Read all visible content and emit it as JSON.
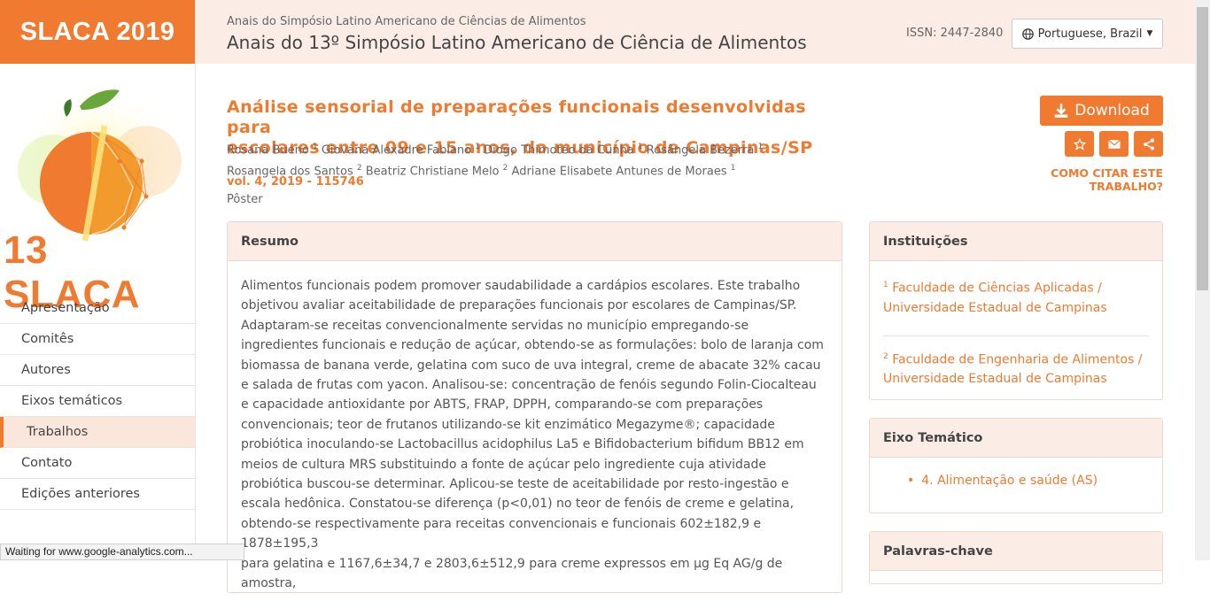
{
  "brand": {
    "title": "SLACA 2019",
    "logo_text": "13 SLACA"
  },
  "nav": {
    "items": [
      {
        "label": "Apresentação"
      },
      {
        "label": "Comitês"
      },
      {
        "label": "Autores"
      },
      {
        "label": "Eixos temáticos"
      },
      {
        "label": "Trabalhos"
      },
      {
        "label": "Contato"
      },
      {
        "label": "Edições anteriores"
      }
    ],
    "active": "Trabalhos"
  },
  "header": {
    "subtitle": "Anais do Simpósio Latino Americano de Ciências de Alimentos",
    "title": "Anais do 13º Simpósio Latino Americano de Ciência de Alimentos",
    "issn": "ISSN: 2447-2840",
    "language": "Portuguese, Brazil"
  },
  "article": {
    "title_line1": "Análise sensorial de preparações funcionais desenvolvidas para",
    "title_line2": "escolares entre 09 e 15 anos, do município de Campinas/SP",
    "authors": [
      {
        "name": "Rosana Bueno",
        "aff": "1"
      },
      {
        "name": "Giovana Alexadre Fabiano",
        "aff": "1"
      },
      {
        "name": "Diogo Thimoteo da Cunha",
        "aff": "1"
      },
      {
        "name": "Rosângela Bezerra",
        "aff": "1"
      },
      {
        "name": "Rosangela dos Santos",
        "aff": "2"
      },
      {
        "name": "Beatriz Christiane Melo",
        "aff": "2"
      },
      {
        "name": "Adriane Elisabete Antunes de Moraes",
        "aff": "1"
      }
    ],
    "volume": "vol. 4, 2019 - 115746",
    "type": "Pôster"
  },
  "actions": {
    "download": "Download",
    "cite": "COMO CITAR ESTE TRABALHO?",
    "icons": [
      "star-icon",
      "envelope-icon",
      "share-icon"
    ]
  },
  "abstract": {
    "heading": "Resumo",
    "lines": [
      "Alimentos funcionais podem promover saudabilidade a cardápios escolares. Este trabalho",
      "objetivou avaliar aceitabilidade de preparações funcionais por escolares de Campinas/SP.",
      "Adaptaram-se receitas convencionalmente servidas no município empregando-se",
      "ingredientes funcionais e redução de açúcar, obtendo-se as formulações: bolo de laranja com",
      "biomassa de banana verde, gelatina com suco de uva integral, creme de abacate 32% cacau",
      "e salada de frutas com yacon. Analisou-se: concentração de fenóis segundo Folin-Ciocalteau",
      "e capacidade antioxidante por ABTS, FRAP, DPPH, comparando-se com preparações",
      "convencionais; teor de frutanos utilizando-se kit enzimático Megazyme®; capacidade",
      "probiótica inoculando-se Lactobacillus acidophilus La5 e Bifidobacterium bifidum BB12 em",
      "meios de cultura MRS substituindo a fonte de açúcar pelo ingrediente cuja atividade",
      "probiótica buscou-se determinar. Aplicou-se teste de aceitabilidade por resto-ingestão e",
      "escala hedônica. Constatou-se diferença (p<0,01) no teor de fenóis de creme e gelatina,",
      "obtendo-se respectivamente para receitas convencionais e funcionais 602±182,9 e 1878±195,3",
      "para gelatina e 1167,6±34,7 e 2803,6±512,9 para creme expressos em μg Eq AG/g de amostra,"
    ]
  },
  "institutions": {
    "heading": "Instituições",
    "items": [
      {
        "num": "1",
        "line1": "Faculdade de Ciências Aplicadas /",
        "line2": "Universidade Estadual de Campinas"
      },
      {
        "num": "2",
        "line1": "Faculdade de Engenharia de Alimentos /",
        "line2": "Universidade Estadual de Campinas"
      }
    ]
  },
  "eixo": {
    "heading": "Eixo Temático",
    "item": "4. Alimentação e saúde (AS)"
  },
  "keywords": {
    "heading": "Palavras-chave"
  },
  "status": "Waiting for www.google-analytics.com...",
  "colors": {
    "accent": "#f07a30",
    "header_bg": "#fbece6"
  }
}
